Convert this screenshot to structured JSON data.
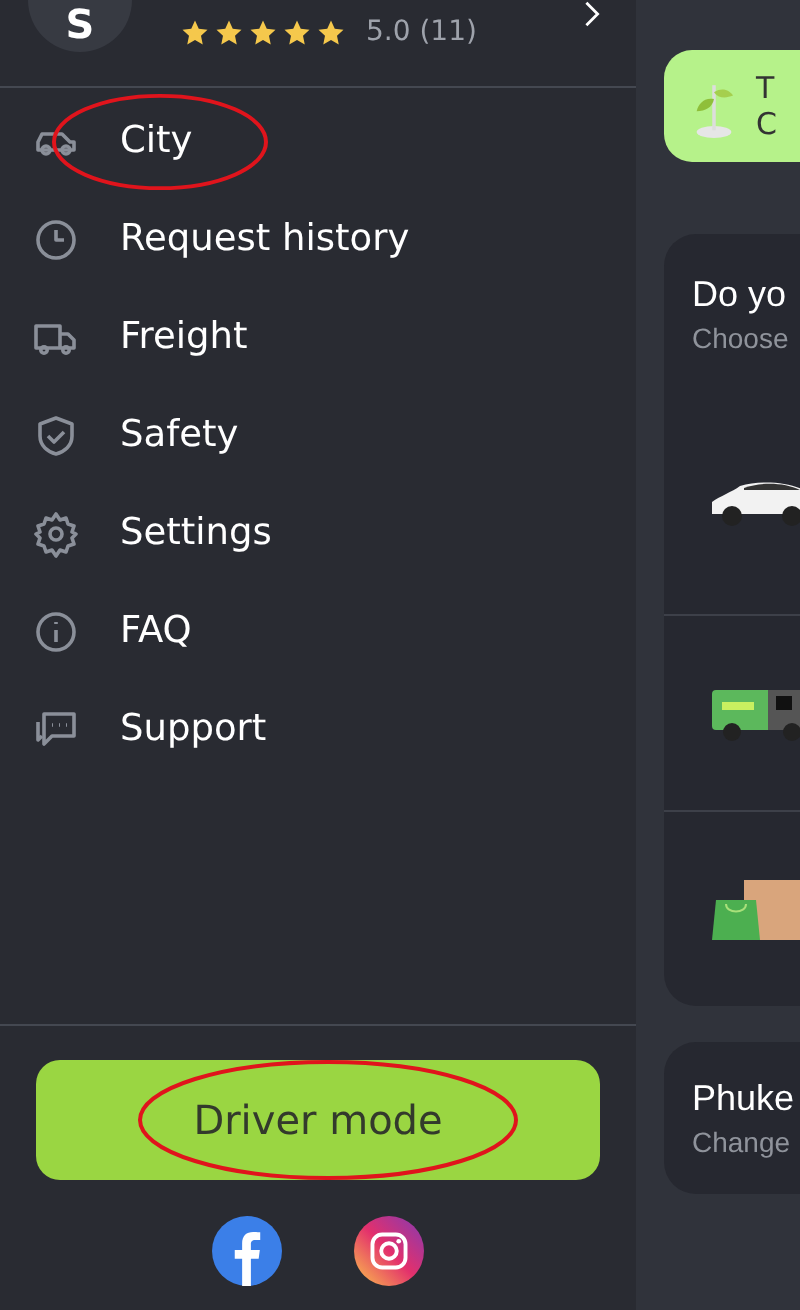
{
  "profile": {
    "initial": "S",
    "stars": 5,
    "rating": "5.0 (11)"
  },
  "menu": [
    {
      "kind": "car",
      "label": "City",
      "circled": true
    },
    {
      "kind": "clock",
      "label": "Request history",
      "circled": false
    },
    {
      "kind": "truck",
      "label": "Freight",
      "circled": false
    },
    {
      "kind": "shield",
      "label": "Safety",
      "circled": false
    },
    {
      "kind": "gear",
      "label": "Settings",
      "circled": false
    },
    {
      "kind": "info",
      "label": "FAQ",
      "circled": false
    },
    {
      "kind": "chat",
      "label": "Support",
      "circled": false
    }
  ],
  "driver_button": {
    "label": "Driver mode",
    "circled": true
  },
  "social": [
    {
      "kind": "facebook"
    },
    {
      "kind": "instagram"
    }
  ],
  "banner": {
    "line_1": "T",
    "line_2": "C"
  },
  "service_card": {
    "title": "Do yo",
    "subtitle": "Choose",
    "options": [
      {
        "kind": "car"
      },
      {
        "kind": "van"
      },
      {
        "kind": "bags"
      }
    ]
  },
  "city_card": {
    "title": "Phuke",
    "subtitle": "Change"
  }
}
